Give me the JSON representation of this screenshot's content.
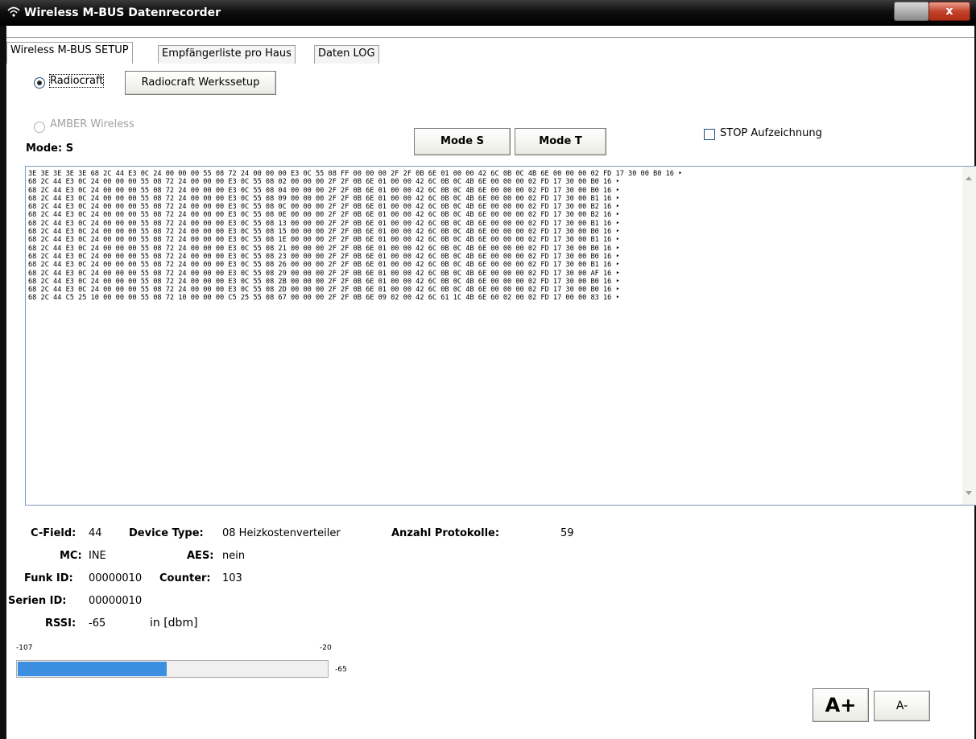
{
  "window": {
    "title": "Wireless M-BUS Datenrecorder",
    "close_glyph": "x"
  },
  "tabs": [
    {
      "label": "Wireless M-BUS SETUP"
    },
    {
      "label": "Empfängerliste pro Haus"
    },
    {
      "label": "Daten LOG"
    }
  ],
  "setup": {
    "radio_radiocraft": "Radiocraft",
    "button_werkssetup": "Radiocraft Werkssetup",
    "radio_amber": "AMBER Wireless",
    "mode_label": "Mode: S",
    "button_mode_s": "Mode S",
    "button_mode_t": "Mode T",
    "stop_checkbox": "STOP Aufzeichnung"
  },
  "log": {
    "text": "3E 3E 3E 3E 3E 68 2C 44 E3 0C 24 00 00 00 55 08 72 24 00 00 00 E3 0C 55 08 FF 00 00 00 2F 2F 0B 6E 01 00 00 42 6C 0B 0C 4B 6E 00 00 00 02 FD 17 30 00 B0 16 ‣\n68 2C 44 E3 0C 24 00 00 00 55 08 72 24 00 00 00 E3 0C 55 08 02 00 00 00 2F 2F 0B 6E 01 00 00 42 6C 0B 0C 4B 6E 00 00 00 02 FD 17 30 00 B0 16 ‣\n68 2C 44 E3 0C 24 00 00 00 55 08 72 24 00 00 00 E3 0C 55 08 04 00 00 00 2F 2F 0B 6E 01 00 00 42 6C 0B 0C 4B 6E 00 00 00 02 FD 17 30 00 B0 16 ‣\n68 2C 44 E3 0C 24 00 00 00 55 08 72 24 00 00 00 E3 0C 55 08 09 00 00 00 2F 2F 0B 6E 01 00 00 42 6C 0B 0C 4B 6E 00 00 00 02 FD 17 30 00 B1 16 ‣\n68 2C 44 E3 0C 24 00 00 00 55 08 72 24 00 00 00 E3 0C 55 08 0C 00 00 00 2F 2F 0B 6E 01 00 00 42 6C 0B 0C 4B 6E 00 00 00 02 FD 17 30 00 B2 16 ‣\n68 2C 44 E3 0C 24 00 00 00 55 08 72 24 00 00 00 E3 0C 55 08 0E 00 00 00 2F 2F 0B 6E 01 00 00 42 6C 0B 0C 4B 6E 00 00 00 02 FD 17 30 00 B2 16 ‣\n68 2C 44 E3 0C 24 00 00 00 55 08 72 24 00 00 00 E3 0C 55 08 13 00 00 00 2F 2F 0B 6E 01 00 00 42 6C 0B 0C 4B 6E 00 00 00 02 FD 17 30 00 B1 16 ‣\n68 2C 44 E3 0C 24 00 00 00 55 08 72 24 00 00 00 E3 0C 55 08 15 00 00 00 2F 2F 0B 6E 01 00 00 42 6C 0B 0C 4B 6E 00 00 00 02 FD 17 30 00 B0 16 ‣\n68 2C 44 E3 0C 24 00 00 00 55 08 72 24 00 00 00 E3 0C 55 08 1E 00 00 00 2F 2F 0B 6E 01 00 00 42 6C 0B 0C 4B 6E 00 00 00 02 FD 17 30 00 B1 16 ‣\n68 2C 44 E3 0C 24 00 00 00 55 08 72 24 00 00 00 E3 0C 55 08 21 00 00 00 2F 2F 0B 6E 01 00 00 42 6C 0B 0C 4B 6E 00 00 00 02 FD 17 30 00 B0 16 ‣\n68 2C 44 E3 0C 24 00 00 00 55 08 72 24 00 00 00 E3 0C 55 08 23 00 00 00 2F 2F 0B 6E 01 00 00 42 6C 0B 0C 4B 6E 00 00 00 02 FD 17 30 00 B0 16 ‣\n68 2C 44 E3 0C 24 00 00 00 55 08 72 24 00 00 00 E3 0C 55 08 26 00 00 00 2F 2F 0B 6E 01 00 00 42 6C 0B 0C 4B 6E 00 00 00 02 FD 17 30 00 B1 16 ‣\n68 2C 44 E3 0C 24 00 00 00 55 08 72 24 00 00 00 E3 0C 55 08 29 00 00 00 2F 2F 0B 6E 01 00 00 42 6C 0B 0C 4B 6E 00 00 00 02 FD 17 30 00 AF 16 ‣\n68 2C 44 E3 0C 24 00 00 00 55 08 72 24 00 00 00 E3 0C 55 08 2B 00 00 00 2F 2F 0B 6E 01 00 00 42 6C 0B 0C 4B 6E 00 00 00 02 FD 17 30 00 B0 16 ‣\n68 2C 44 E3 0C 24 00 00 00 55 08 72 24 00 00 00 E3 0C 55 08 2D 00 00 00 2F 2F 0B 6E 01 00 00 42 6C 0B 0C 4B 6E 00 00 00 02 FD 17 30 00 B0 16 ‣\n68 2C 44 C5 25 10 00 00 00 55 08 72 10 00 00 00 C5 25 55 08 67 00 00 00 2F 2F 0B 6E 09 02 00 42 6C 61 1C 4B 6E 60 02 00 02 FD 17 00 00 83 16 ‣"
  },
  "info": {
    "cfield_label": "C-Field:",
    "cfield_value": "44",
    "device_type_label": "Device Type:",
    "device_type_value": "08 Heizkostenverteiler",
    "protocol_count_label": "Anzahl Protokolle:",
    "protocol_count_value": "59",
    "mc_label": "MC:",
    "mc_value": "INE",
    "aes_label": "AES:",
    "aes_value": "nein",
    "funk_id_label": "Funk ID:",
    "funk_id_value": "00000010",
    "counter_label": "Counter:",
    "counter_value": "103",
    "serien_id_label": "Serien ID:",
    "serien_id_value": "00000010",
    "rssi_label": "RSSI:",
    "rssi_value": "-65",
    "rssi_unit": "in [dbm]"
  },
  "rssi_bar": {
    "min_label": "-107",
    "max_label": "-20",
    "value_label": "-65",
    "min": -107,
    "max": -20,
    "value": -65,
    "fill_color": "#3c8fe0"
  },
  "font_buttons": {
    "increase": "A+",
    "decrease": "A-"
  }
}
